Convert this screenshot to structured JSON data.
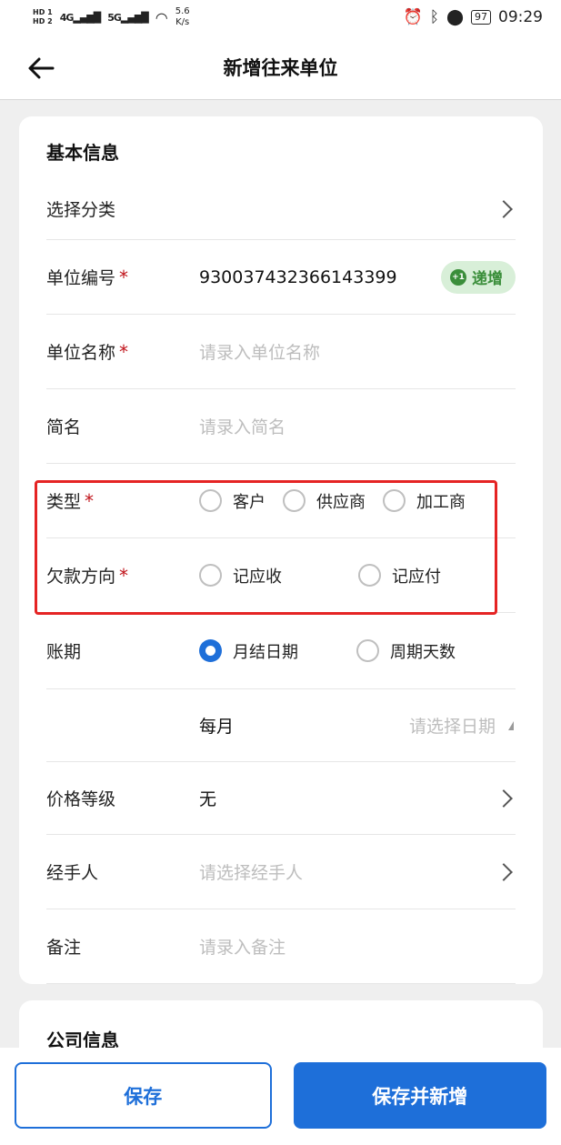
{
  "status_bar": {
    "hd1": "HD 1",
    "hd2": "HD 2",
    "sig1": "4G",
    "sig2": "5G",
    "speed_value": "5.6",
    "speed_unit": "K/s",
    "battery": "97",
    "time": "09:29"
  },
  "header": {
    "title": "新增往来单位"
  },
  "basic": {
    "title": "基本信息",
    "category": {
      "label": "选择分类"
    },
    "code": {
      "label": "单位编号",
      "value": "930037432366143399",
      "increment_label": "递增",
      "increment_badge": "+1"
    },
    "name": {
      "label": "单位名称",
      "placeholder": "请录入单位名称"
    },
    "short_name": {
      "label": "简名",
      "placeholder": "请录入简名"
    },
    "type": {
      "label": "类型",
      "options": [
        "客户",
        "供应商",
        "加工商"
      ]
    },
    "debt_direction": {
      "label": "欠款方向",
      "options": [
        "记应收",
        "记应付"
      ]
    },
    "period": {
      "label": "账期",
      "options": [
        "月结日期",
        "周期天数"
      ],
      "selected": "月结日期"
    },
    "monthly": {
      "label": "每月",
      "placeholder": "请选择日期"
    },
    "price_level": {
      "label": "价格等级",
      "value": "无"
    },
    "handler": {
      "label": "经手人",
      "placeholder": "请选择经手人"
    },
    "remark": {
      "label": "备注",
      "placeholder": "请录入备注"
    },
    "required_mark": "*"
  },
  "company": {
    "title": "公司信息"
  },
  "actions": {
    "save": "保存",
    "save_and_new": "保存并新增"
  },
  "colors": {
    "accent": "#1e6fd9",
    "required": "#c0141b",
    "highlight": "#e52424",
    "increment": "#3a8e3a"
  }
}
